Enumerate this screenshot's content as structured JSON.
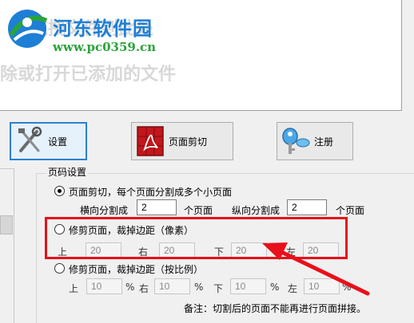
{
  "drop_area": {
    "hint_line1": "拖拽文件到此处",
    "hint_line2": "除或打开已添加的文件"
  },
  "watermark": {
    "title": "河东软件园",
    "url": "www.pc0359.cn"
  },
  "toolbar": {
    "settings_label": "设置",
    "crop_label": "页面剪切",
    "register_label": "注册"
  },
  "page_settings": {
    "group_title": "页码设置",
    "opt_split": {
      "label": "页面剪切，每个页面分割成多个小页面",
      "checked": true,
      "h_label": "横向分割成",
      "h_value": "2",
      "h_unit": "个页面",
      "v_label": "纵向分割成",
      "v_value": "2",
      "v_unit": "个页面"
    },
    "opt_margin_px": {
      "label": "修剪页面，裁掉边距（像素）",
      "checked": false,
      "top_label": "上",
      "top_value": "20",
      "right_label": "右",
      "right_value": "20",
      "bottom_label": "下",
      "bottom_value": "20",
      "left_label": "左",
      "left_value": "20"
    },
    "opt_margin_pct": {
      "label": "修剪页面，裁掉边距（按比例）",
      "checked": false,
      "top_label": "上",
      "top_value": "10",
      "right_label": "右",
      "right_value": "10",
      "bottom_label": "下",
      "bottom_value": "10",
      "left_label": "左",
      "left_value": "10",
      "unit": "%"
    },
    "note": "备注：切割后的页面不能再进行页面拼接。"
  },
  "colors": {
    "highlight": "#e8101a",
    "accent_blue": "#2d7fd0"
  }
}
